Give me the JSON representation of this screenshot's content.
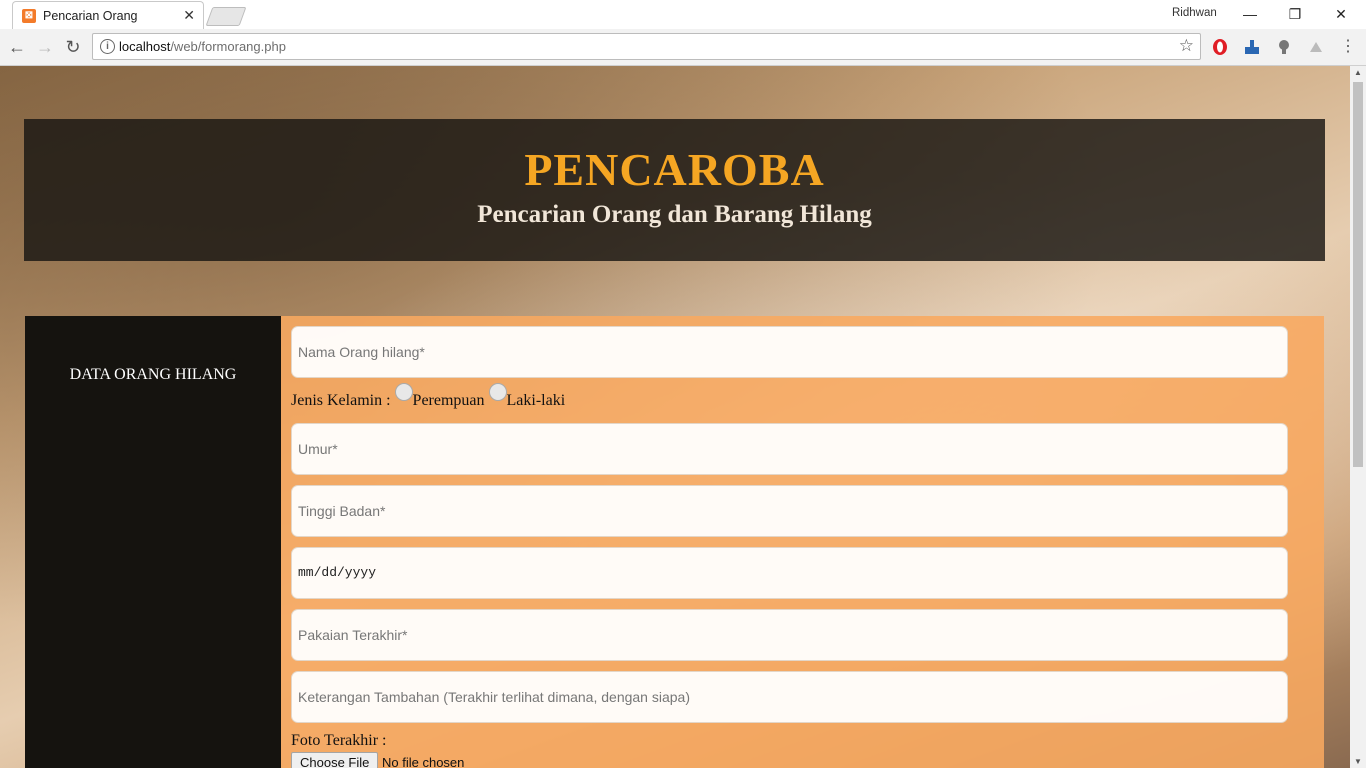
{
  "browser": {
    "tab_title": "Pencarian Orang",
    "tab_favicon_text": "⊠",
    "profile_name": "Ridhwan",
    "url_host": "localhost",
    "url_path": "/web/formorang.php"
  },
  "header": {
    "title": "PENCAROBA",
    "subtitle": "Pencarian Orang dan Barang Hilang"
  },
  "sidebar": {
    "heading": "DATA ORANG HILANG"
  },
  "form": {
    "name_placeholder": "Nama Orang hilang*",
    "gender_label": "Jenis Kelamin :",
    "gender_options": [
      "Perempuan",
      "Laki-laki"
    ],
    "age_placeholder": "Umur*",
    "height_placeholder": "Tinggi Badan*",
    "date_placeholder": "mm/dd/yyyy",
    "clothes_placeholder": "Pakaian Terakhir*",
    "notes_placeholder": "Keterangan Tambahan (Terakhir terlihat dimana, dengan siapa)",
    "photo_label": "Foto Terakhir :",
    "file_button": "Choose File",
    "file_status": "No file chosen"
  }
}
